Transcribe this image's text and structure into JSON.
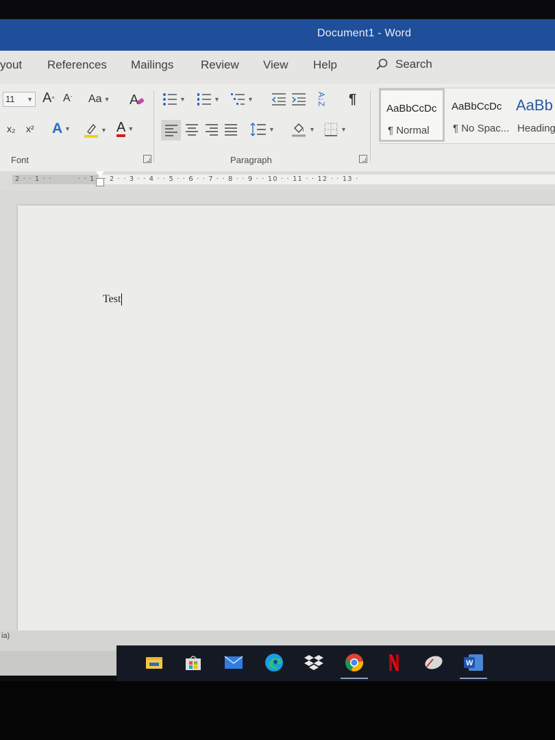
{
  "window": {
    "title": "Document1  -  Word"
  },
  "tabs": [
    "yout",
    "References",
    "Mailings",
    "Review",
    "View",
    "Help"
  ],
  "search": {
    "label": "Search"
  },
  "font_group": {
    "size_value": "11",
    "grow_label": "A",
    "shrink_label": "A",
    "change_case_label": "Aa",
    "subscript_label": "x₂",
    "superscript_label": "x²",
    "text_effects_label": "A",
    "font_color_label": "A",
    "label": "Font"
  },
  "paragraph_group": {
    "sort_label": "A↓Z",
    "pilcrow": "¶",
    "label": "Paragraph"
  },
  "styles": [
    {
      "sample": "AaBbCcDc",
      "name": "¶ Normal",
      "selected": true
    },
    {
      "sample": "AaBbCcDc",
      "name": "¶ No Spac...",
      "selected": false
    },
    {
      "sample": "AaBb",
      "name": "Heading",
      "selected": false
    }
  ],
  "ruler": {
    "numbers": "2 · · 1 · ·         · · 1 · · 2 · · 3 · · 4 · · 5 · · 6 · · 7 · · 8 · · 9 · · 10 · · 11 · · 12 · · 13 ·"
  },
  "document": {
    "text": "Test"
  },
  "status": {
    "text": "ia)"
  },
  "taskbar": [
    "file-explorer-icon",
    "store-icon",
    "mail-icon",
    "edge-icon",
    "dropbox-icon",
    "chrome-icon",
    "netflix-icon",
    "app-icon",
    "word-icon"
  ],
  "colors": {
    "title_bar": "#1f4f9a",
    "ribbon": "#ececea",
    "font_color_underline": "#d01e1e",
    "highlight_yellow": "#f2d400",
    "text_effects_blue": "#2b6cc4"
  }
}
